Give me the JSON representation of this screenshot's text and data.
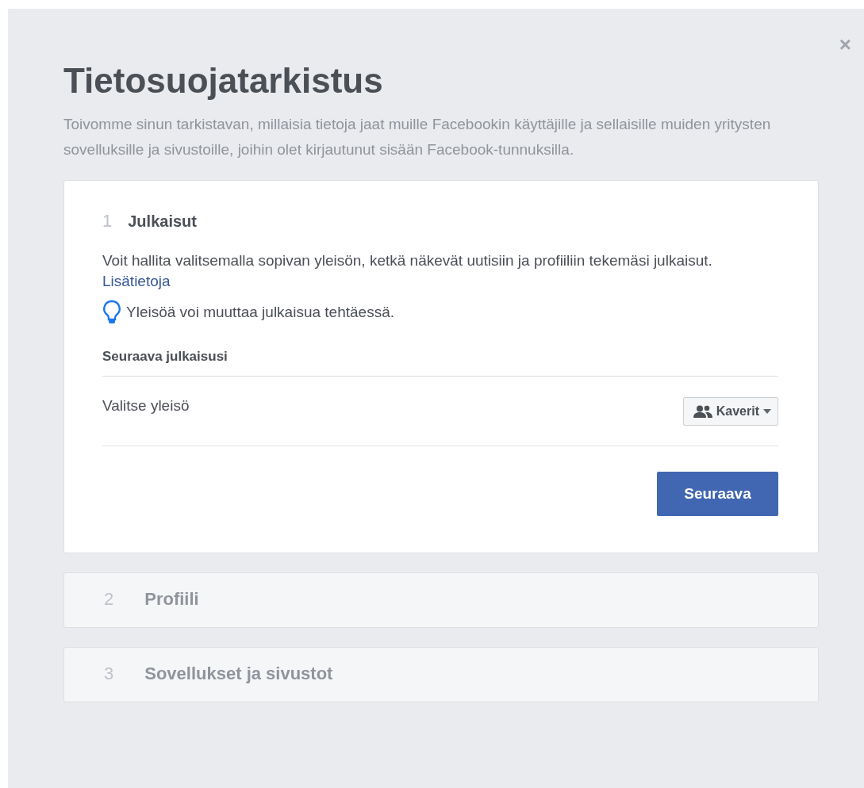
{
  "dialog": {
    "title": "Tietosuojatarkistus",
    "description": "Toivomme sinun tarkistavan, millaisia tietoja jaat muille Facebookin käyttäjille ja sellaisille muiden yritysten sovelluksille ja sivustoille, joihin olet kirjautunut sisään Facebook-tunnuksilla.",
    "close": "×"
  },
  "steps": [
    {
      "number": "1",
      "title": "Julkaisut",
      "expanded": true,
      "text": "Voit hallita valitsemalla sopivan yleisön, ketkä näkevät uutisiin ja profiiliin tekemäsi julkaisut.",
      "link": "Lisätietoja",
      "tip": "Yleisöä voi muuttaa julkaisua tehtäessä.",
      "section_heading": "Seuraava julkaisusi",
      "setting_label": "Valitse yleisö",
      "audience_dropdown": "Kaverit",
      "next_button": "Seuraava"
    },
    {
      "number": "2",
      "title": "Profiili",
      "expanded": false
    },
    {
      "number": "3",
      "title": "Sovellukset ja sivustot",
      "expanded": false
    }
  ]
}
